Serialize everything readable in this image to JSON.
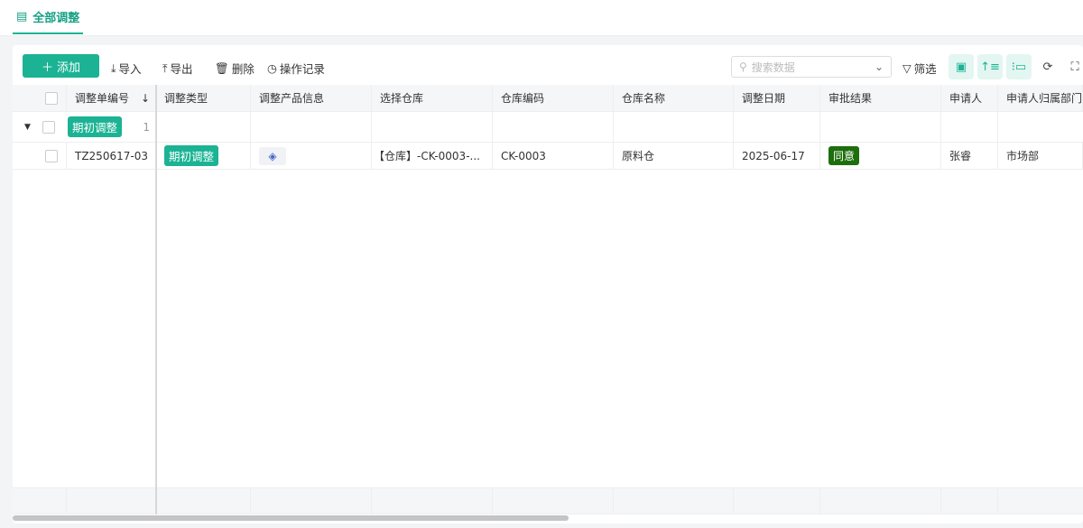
{
  "tab": {
    "label": "全部调整"
  },
  "toolbar": {
    "add": "添加",
    "import": "导入",
    "export": "导出",
    "delete": "删除",
    "log": "操作记录",
    "search_placeholder": "搜索数据",
    "filter": "筛选"
  },
  "columns": [
    "调整单编号",
    "调整类型",
    "调整产品信息",
    "选择仓库",
    "仓库编码",
    "仓库名称",
    "调整日期",
    "审批结果",
    "申请人",
    "申请人归属部门"
  ],
  "group": {
    "label": "期初调整",
    "count": "1"
  },
  "rows": [
    {
      "code": "TZ250617-03",
      "type": "期初调整",
      "warehouse": "【仓库】-CK-0003-...",
      "wh_code": "CK-0003",
      "wh_name": "原料仓",
      "date": "2025-06-17",
      "result": "同意",
      "applicant": "张睿",
      "dept": "市场部"
    }
  ]
}
